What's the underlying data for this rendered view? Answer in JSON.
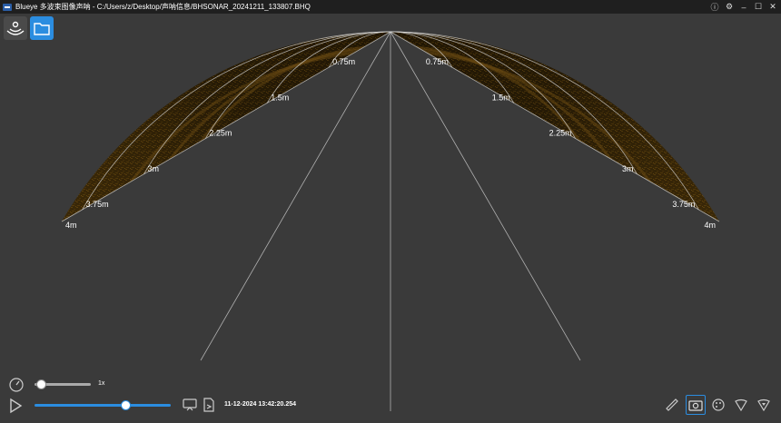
{
  "window": {
    "title": "Blueye 多波束图像声呐 - C:/Users/z/Desktop/声呐信息/BHSONAR_20241211_133807.BHQ",
    "help_icon": "help-icon",
    "settings_icon": "gear-icon",
    "minimize_icon": "minimize-icon",
    "maximize_icon": "maximize-icon",
    "close_icon": "close-icon"
  },
  "toolbar": {
    "sonar_icon": "sonar-icon",
    "folder_icon": "folder-icon",
    "accent": "#2b8de0"
  },
  "sonar": {
    "range_labels_left": [
      "0.75m",
      "1.5m",
      "2.25m",
      "3m",
      "3.75m",
      "4m"
    ],
    "range_labels_right": [
      "0.75m",
      "1.5m",
      "2.25m",
      "3m",
      "3.75m",
      "4m"
    ],
    "max_range_m": 4,
    "echo_color": "#f2b640"
  },
  "playback": {
    "speed_label": "1x",
    "speed_value": 0.05,
    "progress_value": 0.66,
    "timestamp": "11-12-2024 13:42:20.254"
  },
  "tools": [
    "ruler-icon",
    "camera-icon",
    "palette-icon",
    "sector-down-icon",
    "sector-filter-icon"
  ]
}
